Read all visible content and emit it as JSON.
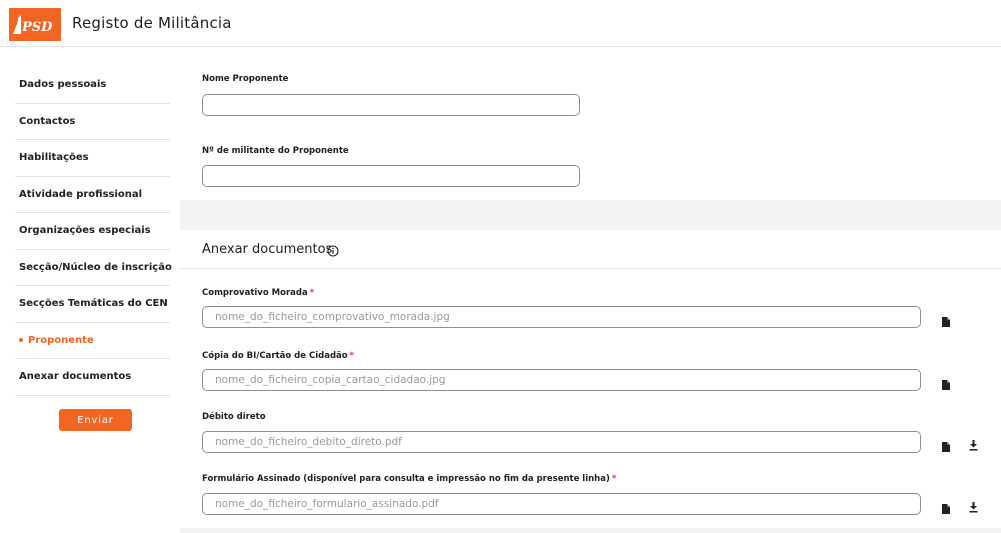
{
  "header": {
    "logo_text": "PSD",
    "title": "Registo de Militância"
  },
  "sidebar": {
    "items": [
      {
        "label": "Dados pessoais"
      },
      {
        "label": "Contactos"
      },
      {
        "label": "Habilitações"
      },
      {
        "label": "Atividade profissional"
      },
      {
        "label": "Organizações especiais"
      },
      {
        "label": "Secção/Núcleo de inscrição"
      },
      {
        "label": "Secções Temáticas do CEN"
      },
      {
        "label": "Proponente",
        "active": true
      },
      {
        "label": "Anexar documentos"
      }
    ],
    "send_label": "Enviar"
  },
  "proponente": {
    "nome_label": "Nome Proponente",
    "nome_value": "",
    "militante_label": "Nº de militante do Proponente",
    "militante_value": ""
  },
  "anexar": {
    "title": "Anexar documentos",
    "files": [
      {
        "label": "Comprovativo Morada",
        "required": "*",
        "filename": "nome_do_ficheiro_comprovativo_morada.jpg"
      },
      {
        "label": "Cópia do BI/Cartão de Cidadão",
        "required": "*",
        "filename": "nome_do_ficheiro_copia_cartao_cidadao.jpg"
      },
      {
        "label": "Débito direto",
        "required": "",
        "filename": "nome_do_ficheiro_debito_direto.pdf"
      },
      {
        "label": "Formulário Assinado (disponível para consulta e impressão no fim da presente linha)",
        "required": "*",
        "filename": "nome_do_ficheiro_formulario_assinado.pdf"
      }
    ]
  },
  "colors": {
    "accent": "#f26522",
    "required": "#e53935"
  },
  "icons": [
    "file-icon",
    "download-icon",
    "info-icon"
  ]
}
